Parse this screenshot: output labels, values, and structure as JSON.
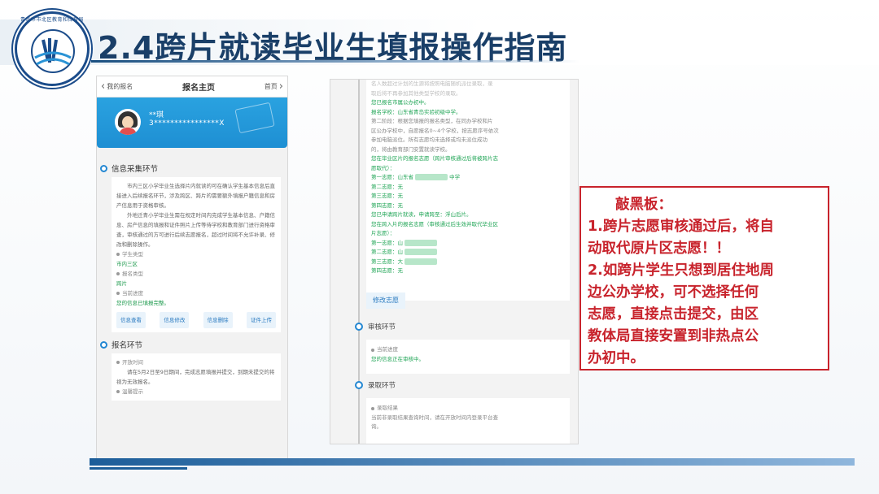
{
  "slide": {
    "title": "2.4跨片就读毕业生填报操作指南",
    "logo_text": "青岛市市北区教育和体育局"
  },
  "phone1": {
    "nav": {
      "back": "我的报名",
      "title": "报名主页",
      "home": "首页"
    },
    "user": {
      "name": "**琪",
      "id": "3****************X"
    },
    "section_info": {
      "title": "信息采集环节",
      "para1": "市内三区小学毕业生选择片内就读的可在确认学生基本信息后直接进入后续报名环节，涉及跨区、跨片的需要额外填报户籍信息和房产信息用于资格审核。",
      "para2": "外地迁青小学毕业生需在规定时间内完成学生基本信息、户籍信息、房产信息的填报和证件照片上传等待学校和教育部门进行资格审查，审核通过的方可进行后续志愿报名，超过时间将不允许补录、修改和删除操作。",
      "student_type_label": "学生类型",
      "student_type_value": "市内三区",
      "apply_type_label": "报名类型",
      "apply_type_value": "跨片",
      "progress_label": "当前进度",
      "progress_value": "您的信息已填报完整。",
      "buttons": [
        "信息查看",
        "信息修改",
        "信息删除",
        "证件上传"
      ]
    },
    "section_apply": {
      "title": "报名环节",
      "time_label": "开放时间",
      "time_text": "请在5月2日至9日期间，完成志愿填报并提交，到期未提交的将视为无效报名。",
      "tip_label": "温馨提示"
    }
  },
  "phone2": {
    "top_text_1": "名人数超过计划的生源将按照电脑随机派位录取，录",
    "top_text_2": "取后将不再参加其他类型学校的录取。",
    "done_text": "您已报名市属公办初中。",
    "school_line": "报名学校：山东省青岛实验初级中学。",
    "stage2_1": "第二阶段：根据您填报的报名类型，在同办学校和片",
    "stage2_2": "区公办学校中，自愿报名0~4个学校，按志愿序号依次",
    "stage2_3": "参加电脑派位。所有志愿均未选择或均未派位成功",
    "stage2_4": "的，将由教育部门安置就读学校。",
    "cross_head_1": "您在毕业区片的报名志愿（跨片审核通过后将被跨片志",
    "cross_head_2": "愿取代）：",
    "wish1_a": "第一志愿：山东省",
    "wish1_b": "中学",
    "wish2": "第二志愿：无",
    "wish3": "第三志愿：无",
    "wish4": "第四志愿：无",
    "cross_apply": "您已申请跨片就读，申请跨至：浮山后片。",
    "cross_wish_1": "您在跨入片的报名志愿（审核通过后生效并取代毕业区",
    "cross_wish_2": "片志愿）：",
    "cwish1": "第一志愿：山",
    "cwish2": "第二志愿：山",
    "cwish3": "第三志愿：大",
    "cwish4": "第四志愿：无",
    "modify_button": "修改志愿",
    "review": {
      "title": "审核环节",
      "label": "当前进度",
      "value": "您的信息正在审核中。"
    },
    "admit": {
      "title": "录取环节",
      "label": "录取结果",
      "text_1": "当前非录取结果查询时间，请在开放时间内登录平台查",
      "text_2": "询。"
    }
  },
  "callout": {
    "title": "敲黑板：",
    "lines": [
      "1.跨片志愿审核通过后，将自",
      "动取代原片区志愿！！",
      "2.如跨片学生只想到居住地周",
      "边公办学校，可不选择任何",
      "志愿，直接点击提交，由区",
      "教体局直接安置到非热点公",
      "办初中。"
    ]
  },
  "colors": {
    "title": "#1a3f68",
    "accent_blue": "#2387d2",
    "green_text": "#20a556",
    "callout_red": "#c8232c"
  }
}
